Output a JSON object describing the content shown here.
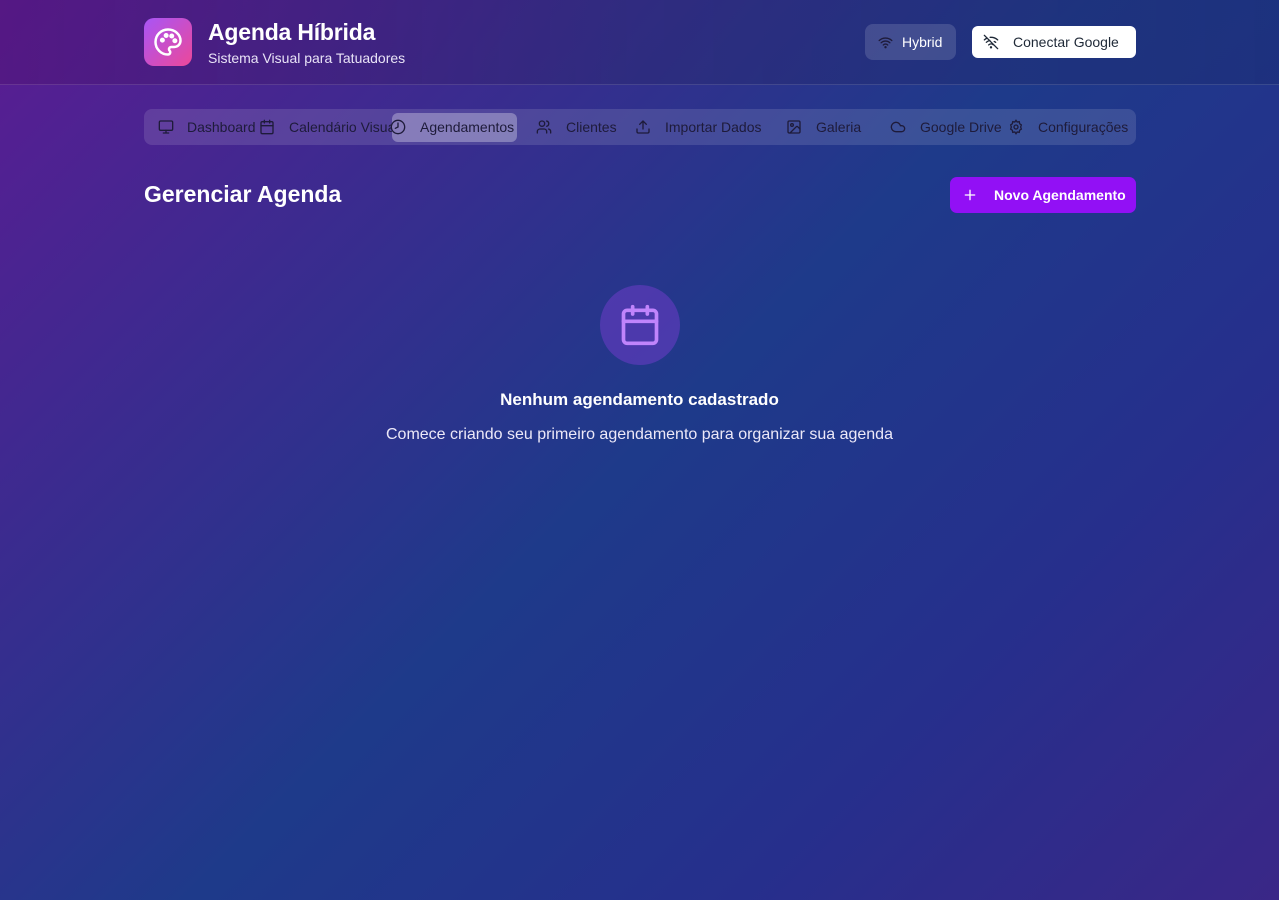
{
  "header": {
    "title": "Agenda Híbrida",
    "subtitle": "Sistema Visual para Tatuadores",
    "logo_icon": "palette-icon",
    "hybrid_label": "Hybrid",
    "hybrid_icon": "wifi-icon",
    "google_label": "Conectar Google",
    "google_icon": "wifi-off-icon"
  },
  "nav": {
    "active_tab": "Agendamentos",
    "tabs": [
      {
        "label": "Dashboard",
        "icon": "monitor-icon"
      },
      {
        "label": "Calendário Visual",
        "icon": "calendar-icon"
      },
      {
        "label": "Agendamentos",
        "icon": "clock-icon"
      },
      {
        "label": "Clientes",
        "icon": "users-icon"
      },
      {
        "label": "Importar Dados",
        "icon": "upload-icon"
      },
      {
        "label": "Galeria",
        "icon": "image-icon"
      },
      {
        "label": "Google Drive",
        "icon": "cloud-icon"
      },
      {
        "label": "Configurações",
        "icon": "gear-icon"
      }
    ]
  },
  "main": {
    "title": "Gerenciar Agenda",
    "new_button_label": "Novo Agendamento",
    "new_button_icon": "plus-icon",
    "empty_state": {
      "icon": "calendar-icon",
      "title": "Nenhum agendamento cadastrado",
      "description": "Comece criando seu primeiro agendamento para organizar sua agenda"
    }
  },
  "colors": {
    "accent": "#9210f5",
    "logo_gradient_start": "#a855f7",
    "logo_gradient_end": "#ec4899",
    "empty_icon": "#c084fc"
  }
}
